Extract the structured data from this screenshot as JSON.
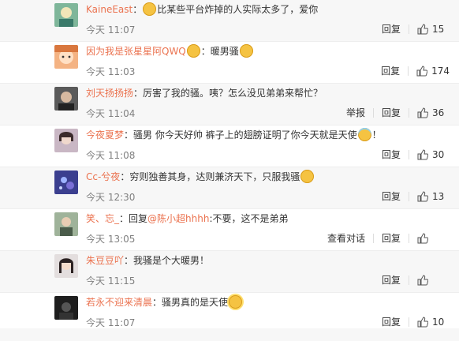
{
  "comments": [
    {
      "avatar": "avatar-photo-icon",
      "name": "KaineEast",
      "sep": "：",
      "text": "比某些平台炸掉的人实际太多了，爱你",
      "emoji_before": "facepalm-emoji-icon",
      "time": "今天 11:07",
      "actions": [
        "回复"
      ],
      "likes": "15"
    },
    {
      "avatar": "avatar-anime-icon",
      "name": "因为我是张星星阿QWQ",
      "text": "：暖男骚",
      "time": "今天 11:03",
      "actions": [
        "回复"
      ],
      "likes": "174"
    },
    {
      "avatar": "avatar-photo-icon",
      "name": "刘天扬扬扬",
      "text": "：厉害了我的骚。咦？怎么没见弟弟来帮忙？",
      "time": "今天 11:04",
      "actions": [
        "举报",
        "回复"
      ],
      "likes": "36"
    },
    {
      "avatar": "avatar-photo-icon",
      "name": "今夜夏梦",
      "text": "：骚男 你今天好帅 裤子上的翅膀证明了你今天就是天使",
      "text_after": "！",
      "time": "今天 11:08",
      "actions": [
        "回复"
      ],
      "likes": "30"
    },
    {
      "avatar": "avatar-photo-icon",
      "name": "Cc-兮夜",
      "text": "：穷则独善其身，达则兼济天下，只服我骚",
      "time": "今天 12:30",
      "actions": [
        "回复"
      ],
      "likes": "13"
    },
    {
      "avatar": "avatar-photo-icon",
      "name": "笑、忘_",
      "text": "：回复",
      "mention": "@陈小超hhhh",
      "text_after": ":不要，这不是弟弟",
      "time": "今天 13:05",
      "actions": [
        "查看对话",
        "回复"
      ],
      "likes": ""
    },
    {
      "avatar": "avatar-photo-icon",
      "name": "朱豆豆吖",
      "text": "：我骚是个大暖男！",
      "time": "今天 11:15",
      "actions": [
        "回复"
      ],
      "likes": ""
    },
    {
      "avatar": "avatar-photo-icon",
      "name": "若永不迎来清晨",
      "text": "：骚男真的是天使",
      "time": "今天 11:07",
      "actions": [
        "回复"
      ],
      "likes": "10"
    }
  ],
  "colors": {
    "username": "#eb7350",
    "meta": "#808080",
    "stripe": "#f7f7f7"
  }
}
